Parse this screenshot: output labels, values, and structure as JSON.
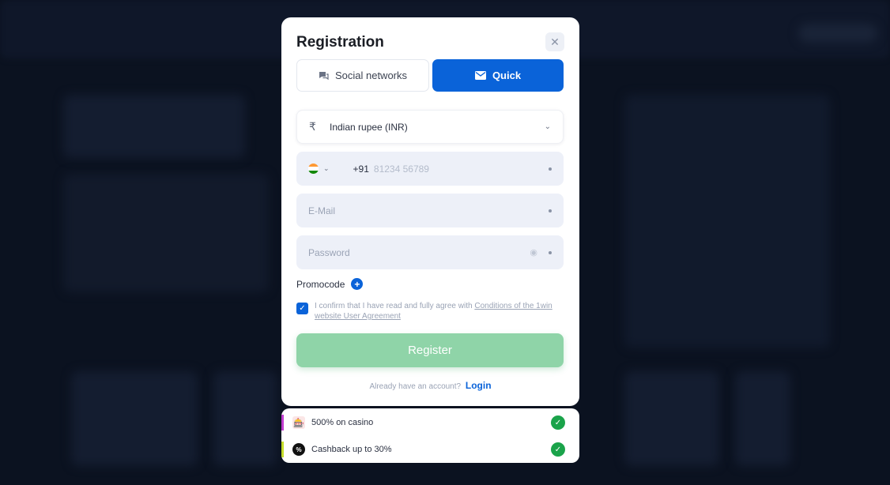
{
  "modal": {
    "title": "Registration",
    "close_symbol": "✕",
    "tabs": [
      {
        "label": "Social networks",
        "icon": "chat-icon",
        "active": false
      },
      {
        "label": "Quick",
        "icon": "envelope-icon",
        "active": true
      }
    ],
    "currency": {
      "symbol": "₹",
      "value": "Indian rupee (INR)"
    },
    "phone": {
      "country_code": "+91",
      "placeholder": "81234 56789"
    },
    "email": {
      "placeholder": "E-Mail"
    },
    "password": {
      "placeholder": "Password"
    },
    "promocode_label": "Promocode",
    "agreement": {
      "text": "I confirm that I have read and fully agree with ",
      "link": "Conditions of the 1win website User Agreement",
      "checked": true
    },
    "register_label": "Register",
    "login_prompt": "Already have an account?",
    "login_link": "Login"
  },
  "bonuses": [
    {
      "text": "500% on casino",
      "accent": "#c13ccf"
    },
    {
      "text": "Cashback up to 30%",
      "accent": "#c6dd2b"
    }
  ],
  "colors": {
    "primary": "#0a63d9",
    "register": "#8fd4a8",
    "success": "#1aa34a"
  }
}
